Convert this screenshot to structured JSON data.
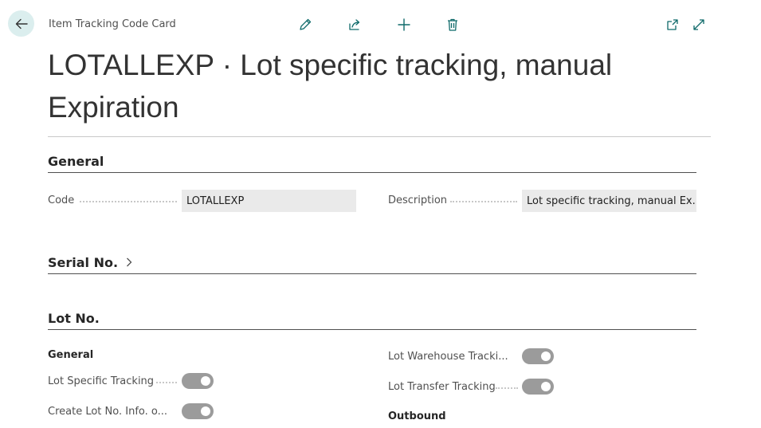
{
  "header": {
    "caption": "Item Tracking Code Card",
    "title": "LOTALLEXP · Lot specific tracking, manual Expiration"
  },
  "toolbar": {
    "icons": [
      "edit-icon",
      "share-icon",
      "add-icon",
      "delete-icon",
      "open-new-window-icon",
      "expand-icon"
    ]
  },
  "sections": {
    "general": {
      "title": "General"
    },
    "serial": {
      "title": "Serial No."
    },
    "lot": {
      "title": "Lot No."
    }
  },
  "fields": {
    "code": {
      "label": "Code",
      "value": "LOTALLEXP"
    },
    "description": {
      "label": "Description",
      "value": "Lot specific tracking, manual Ex..."
    }
  },
  "lot": {
    "general_title": "General",
    "outbound_title": "Outbound",
    "lot_specific_tracking": {
      "label": "Lot Specific Tracking",
      "on": true
    },
    "create_lot_info": {
      "label": "Create Lot No. Info. o...",
      "on": true
    },
    "lot_warehouse_tracking": {
      "label": "Lot Warehouse Tracki...",
      "on": true
    },
    "lot_transfer_tracking": {
      "label": "Lot Transfer Tracking",
      "on": true
    }
  },
  "colors": {
    "accent": "#0f6a6a",
    "back_bg": "#dbeeee",
    "toggle_on": "#9b9b9b"
  }
}
